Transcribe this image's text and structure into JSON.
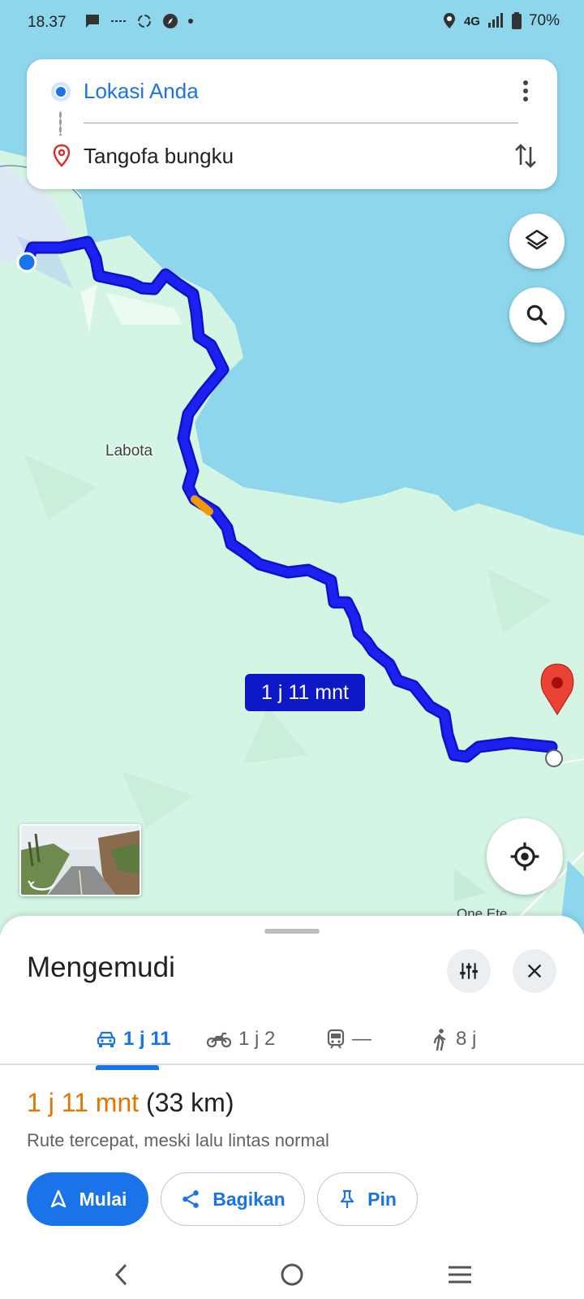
{
  "status_bar": {
    "time": "18.37",
    "network": "4G",
    "battery": "70%"
  },
  "directions": {
    "origin": "Lokasi Anda",
    "destination": "Tangofa bungku"
  },
  "map": {
    "route_label": "1 j 11 mnt",
    "place_label": "Labota",
    "place_label_2": "One Ete",
    "colors": {
      "water": "#8ed6ec",
      "land": "#d4f5e3",
      "route": "#1016e8",
      "traffic": "#f29900"
    }
  },
  "sheet": {
    "title": "Mengemudi",
    "tabs": [
      {
        "label": "1 j 11",
        "icon": "car-icon"
      },
      {
        "label": "1 j 2",
        "icon": "motorcycle-icon"
      },
      {
        "label": "—",
        "icon": "train-icon"
      },
      {
        "label": "8 j",
        "icon": "walk-icon"
      }
    ],
    "duration": "1 j 11 mnt",
    "distance": "(33 km)",
    "description": "Rute tercepat, meski lalu lintas normal",
    "buttons": {
      "start": "Mulai",
      "share": "Bagikan",
      "pin": "Pin"
    }
  }
}
